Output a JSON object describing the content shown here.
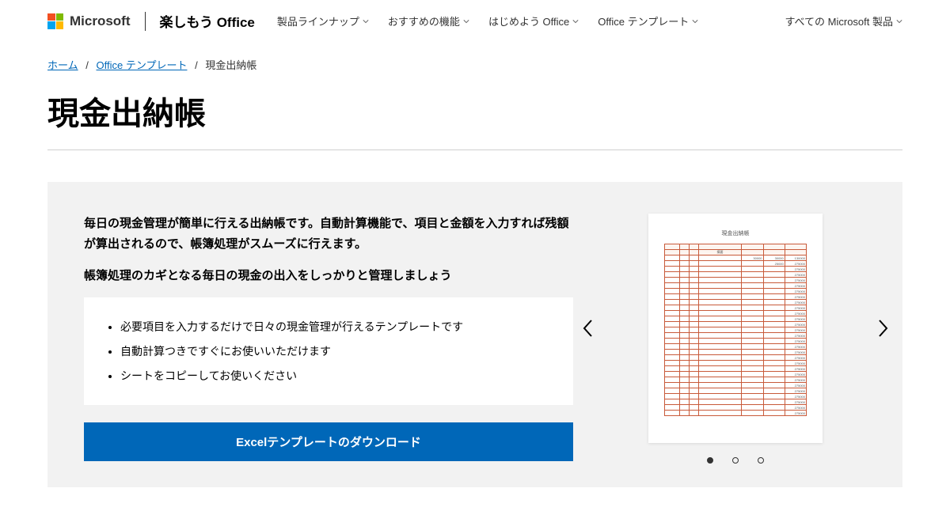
{
  "header": {
    "microsoft": "Microsoft",
    "brand": "楽しもう Office",
    "nav": [
      "製品ラインナップ",
      "おすすめの機能",
      "はじめよう Office",
      "Office テンプレート"
    ],
    "all_products": "すべての Microsoft 製品"
  },
  "breadcrumb": {
    "home": "ホーム",
    "templates": "Office テンプレート",
    "current": "現金出納帳"
  },
  "page_title": "現金出納帳",
  "hero": {
    "lead": "毎日の現金管理が簡単に行える出納帳です。自動計算機能で、項目と金額を入力すれば残額が算出されるので、帳簿処理がスムーズに行えます。",
    "sublead": "帳簿処理のカギとなる毎日の現金の出入をしっかりと管理しましょう",
    "bullets": [
      "必要項目を入力するだけで日々の現金管理が行えるテンプレートです",
      "自動計算つきですぐにお使いいただけます",
      "シートをコピーしてお使いください"
    ],
    "download_label": "Excelテンプレートのダウンロード"
  },
  "preview": {
    "title": "現金出納帳"
  }
}
